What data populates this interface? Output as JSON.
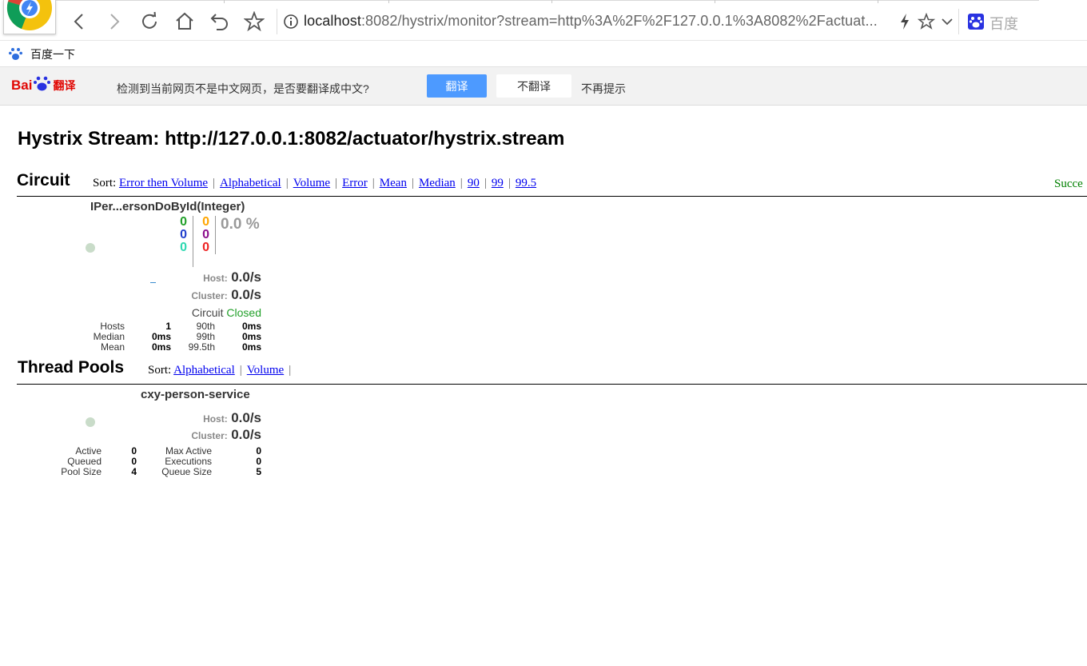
{
  "browser": {
    "url_host": "localhost",
    "url_rest": ":8082/hystrix/monitor?stream=http%3A%2F%2F127.0.0.1%3A8082%2Factuat...",
    "search_engine_label": "百度",
    "bookmark_item": "百度一下"
  },
  "translate_bar": {
    "brand_left": "Bai",
    "brand_right": "翻译",
    "message": "检测到当前网页不是中文网页，是否要翻译成中文?",
    "translate_button": "翻译",
    "no_translate_button": "不翻译",
    "never_show": "不再提示"
  },
  "page": {
    "title": "Hystrix Stream: http://127.0.0.1:8082/actuator/hystrix.stream",
    "status_text": "Succe",
    "status_color": "#008000"
  },
  "circuit": {
    "heading": "Circuit",
    "sort_label": "Sort:",
    "sort_options": [
      "Error then Volume",
      "Alphabetical",
      "Volume",
      "Error",
      "Mean",
      "Median",
      "90",
      "99",
      "99.5"
    ],
    "card": {
      "name": "IPer...ersonDoById(Integer)",
      "counts_col1": [
        "0",
        "0",
        "0"
      ],
      "counts_col1_colors": [
        "#22a02a",
        "#1f3ecc",
        "#2dd8b0"
      ],
      "counts_col2": [
        "0",
        "0",
        "0"
      ],
      "counts_col2_colors": [
        "#ffa500",
        "#8b0e8b",
        "#ee2222"
      ],
      "error_pct": "0.0 %",
      "host_label": "Host:",
      "host_rate": "0.0/s",
      "cluster_label": "Cluster:",
      "cluster_rate": "0.0/s",
      "circuit_label": "Circuit",
      "circuit_state": "Closed",
      "stats": {
        "hosts_label": "Hosts",
        "hosts_value": "1",
        "median_label": "Median",
        "median_value": "0ms",
        "mean_label": "Mean",
        "mean_value": "0ms",
        "p90_label": "90th",
        "p90_value": "0ms",
        "p99_label": "99th",
        "p99_value": "0ms",
        "p995_label": "99.5th",
        "p995_value": "0ms"
      }
    }
  },
  "thread_pools": {
    "heading": "Thread Pools",
    "sort_label": "Sort:",
    "sort_options": [
      "Alphabetical",
      "Volume"
    ],
    "card": {
      "name": "cxy-person-service",
      "host_label": "Host:",
      "host_rate": "0.0/s",
      "cluster_label": "Cluster:",
      "cluster_rate": "0.0/s",
      "stats": {
        "active_label": "Active",
        "active_value": "0",
        "queued_label": "Queued",
        "queued_value": "0",
        "pool_size_label": "Pool Size",
        "pool_size_value": "4",
        "max_active_label": "Max Active",
        "max_active_value": "0",
        "executions_label": "Executions",
        "executions_value": "0",
        "queue_size_label": "Queue Size",
        "queue_size_value": "5"
      }
    }
  }
}
